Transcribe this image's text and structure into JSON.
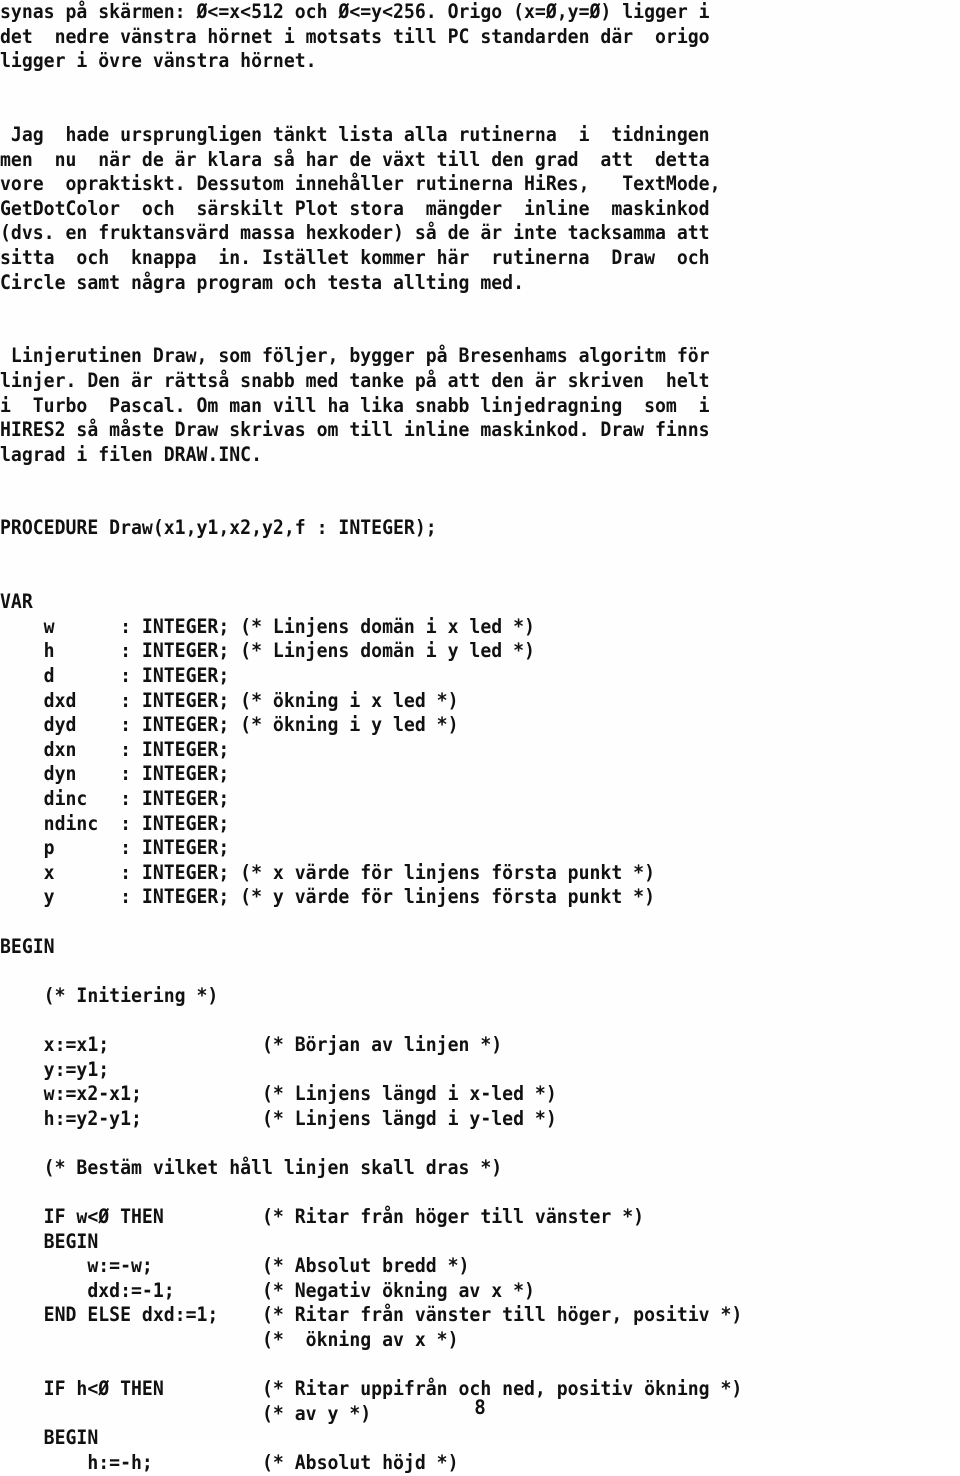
{
  "document": {
    "language": "sv",
    "page_number": "8",
    "kind": "pascal-source-listing"
  },
  "body_lines": [
    "synas på skärmen: Ø<=x<512 och Ø<=y<256. Origo (x=Ø,y=Ø) ligger i",
    "det  nedre vänstra hörnet i motsats till PC standarden där  origo",
    "ligger i övre vänstra hörnet.",
    "",
    "",
    " Jag  hade ursprungligen tänkt lista alla rutinerna  i  tidningen",
    "men  nu  när de är klara så har de växt till den grad  att  detta",
    "vore  opraktiskt. Dessutom innehåller rutinerna HiRes,   TextMode,",
    "GetDotColor  och  särskilt Plot stora  mängder  inline  maskinkod",
    "(dvs. en fruktansvärd massa hexkoder) så de är inte tacksamma att",
    "sitta  och  knappa  in. Istället kommer här  rutinerna  Draw  och",
    "Circle samt några program och testa allting med.",
    "",
    "",
    " Linjerutinen Draw, som följer, bygger på Bresenhams algoritm för",
    "linjer. Den är rättså snabb med tanke på att den är skriven  helt",
    "i  Turbo  Pascal. Om man vill ha lika snabb linjedragning  som  i",
    "HIRES2 så måste Draw skrivas om till inline maskinkod. Draw finns",
    "lagrad i filen DRAW.INC.",
    "",
    "",
    "PROCEDURE Draw(x1,y1,x2,y2,f : INTEGER);",
    "",
    "",
    "VAR",
    "    w      : INTEGER; (* Linjens domän i x led *)",
    "    h      : INTEGER; (* Linjens domän i y led *)",
    "    d      : INTEGER;",
    "    dxd    : INTEGER; (* ökning i x led *)",
    "    dyd    : INTEGER; (* ökning i y led *)",
    "    dxn    : INTEGER;",
    "    dyn    : INTEGER;",
    "    dinc   : INTEGER;",
    "    ndinc  : INTEGER;",
    "    p      : INTEGER;",
    "    x      : INTEGER; (* x värde för linjens första punkt *)",
    "    y      : INTEGER; (* y värde för linjens första punkt *)",
    "",
    "BEGIN",
    "",
    "    (* Initiering *)",
    "",
    "    x:=x1;              (* Början av linjen *)",
    "    y:=y1;",
    "    w:=x2-x1;           (* Linjens längd i x-led *)",
    "    h:=y2-y1;           (* Linjens längd i y-led *)",
    "",
    "    (* Bestäm vilket håll linjen skall dras *)",
    "",
    "    IF w<Ø THEN         (* Ritar från höger till vänster *)",
    "    BEGIN",
    "        w:=-w;          (* Absolut bredd *)",
    "        dxd:=-1;        (* Negativ ökning av x *)",
    "    END ELSE dxd:=1;    (* Ritar från vänster till höger, positiv *)",
    "                        (*  ökning av x *)",
    "",
    "    IF h<Ø THEN         (* Ritar uppifrån och ned, positiv ökning *)",
    "                        (* av y *)",
    "    BEGIN",
    "        h:=-h;          (* Absolut höjd *)"
  ]
}
